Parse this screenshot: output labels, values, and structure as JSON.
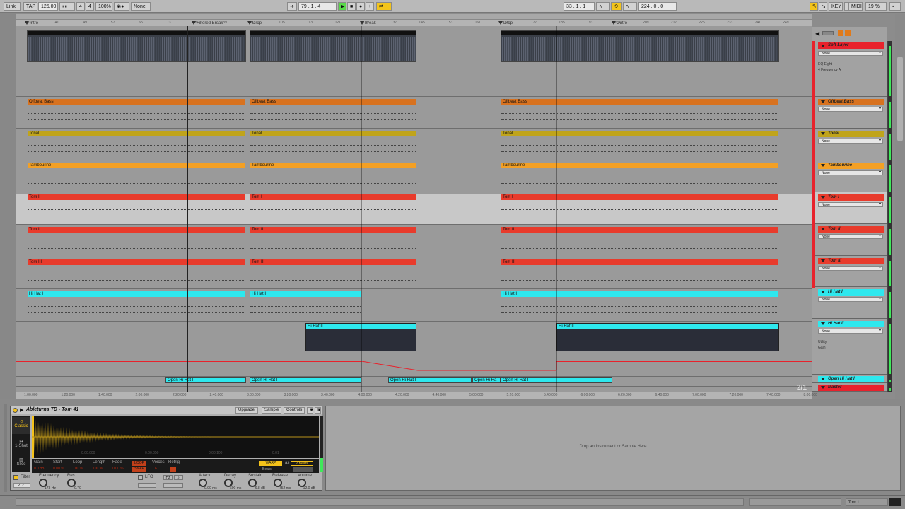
{
  "transport": {
    "link": "Link",
    "tap": "TAP",
    "tempo": "125.00",
    "sig_num": "4",
    "sig_den": "4",
    "zoom": "100%",
    "quant": "None",
    "position": "79 .  1 .  4",
    "loop_start": "33 .  1 .  1",
    "loop_length": "224 .  0 .  0",
    "key": "KEY",
    "midi": "MIDI",
    "cpu": "19 %"
  },
  "ruler": {
    "bars": [
      "33",
      "41",
      "49",
      "57",
      "65",
      "73",
      "81",
      "89",
      "97",
      "105",
      "113",
      "121",
      "129",
      "137",
      "145",
      "153",
      "161",
      "169",
      "177",
      "185",
      "193",
      "201",
      "209",
      "217",
      "225",
      "233",
      "241",
      "249"
    ],
    "locators": [
      "Intro",
      "Filtered Break",
      "Drop",
      "Break",
      "Drop",
      "Outro"
    ],
    "times": [
      "1:00:000",
      "1:20:000",
      "1:40:000",
      "2:00:000",
      "2:20:000",
      "2:40:000",
      "3:00:000",
      "3:20:000",
      "3:40:000",
      "4:00:000",
      "4:20:000",
      "4:40:000",
      "5:00:000",
      "5:20:000",
      "5:40:000",
      "6:00:000",
      "6:20:000",
      "6:40:000",
      "7:00:000",
      "7:20:000",
      "7:40:000",
      "8:00:000"
    ]
  },
  "tracks": [
    {
      "name": "Soft Layer",
      "color": "#e8222c",
      "device": "None",
      "auto1": "EQ Eight",
      "auto2": "4 Frequency A",
      "clips": []
    },
    {
      "name": "Offbeat Bass",
      "color": "#d8721f",
      "device": "None",
      "clips": [
        "Offbeat Bass",
        "Offbeat Bass",
        "Offbeat Bass"
      ]
    },
    {
      "name": "Tonal",
      "color": "#c0a41b",
      "device": "None",
      "clips": [
        "Tonal",
        "Tonal",
        "Tonal"
      ]
    },
    {
      "name": "Tambourine",
      "color": "#f3a025",
      "device": "None",
      "clips": [
        "Tambourine",
        "Tambourine",
        "Tambourine"
      ]
    },
    {
      "name": "Tom I",
      "color": "#e83b2c",
      "device": "None",
      "clips": [
        "Tom I",
        "Tom I",
        "Tom I"
      ]
    },
    {
      "name": "Tom II",
      "color": "#e83b2c",
      "device": "None",
      "clips": [
        "Tom II",
        "Tom II",
        "Tom II"
      ]
    },
    {
      "name": "Tom III",
      "color": "#e83b2c",
      "device": "None",
      "clips": [
        "Tom III",
        "Tom III",
        "Tom III"
      ]
    },
    {
      "name": "Hi Hat I",
      "color": "#2ee8ee",
      "device": "None",
      "clips": [
        "Hi Hat I",
        "Hi Hat I",
        "Hi Hat I"
      ]
    },
    {
      "name": "Hi Hat II",
      "color": "#2ee8ee",
      "device": "None",
      "auto1": "Utility",
      "auto2": "Gain",
      "clips": [
        "Hi Hat II",
        "Hi Hat II"
      ]
    },
    {
      "name": "Open Hi Hat I",
      "color": "#2ee8ee",
      "clips": [
        "Open Hi Hat I",
        "Open Hi Hat I",
        "Open Hi Hat I",
        "Open Hi Ha",
        "Open Hi Hat I"
      ]
    },
    {
      "name": "Master",
      "color": "#e8222c"
    }
  ],
  "page_indicator": "2/1",
  "device": {
    "title": "Ableturns TD - Tom 41",
    "tabs": [
      "Upgrade",
      "Sample",
      "Controls"
    ],
    "mode_label": "Classic",
    "mode2": "1-Shot",
    "mode3": "Slice",
    "ticks": [
      "0:00:000",
      "0:00:050",
      "0:00:100",
      "0:01"
    ],
    "params": [
      "Gain",
      "Start",
      "Loop",
      "Length",
      "Fade",
      "Voices",
      "Retrig"
    ],
    "param_vals": [
      "0.0 dB",
      "0.00 %",
      "100 %",
      "100 %",
      "0.00 %",
      "6",
      "Off"
    ],
    "warp": "WARP",
    "beats_val": "2 Beats",
    "beats": "Beats",
    "loop_btn": "LOOP",
    "snap_btn": "SNAP",
    "filter": "Filter",
    "filter_type": "LP12",
    "frequency": "Frequency",
    "freq_val": "173 Hz",
    "res": "Res",
    "res_val": "0.70",
    "lfo": "LFO",
    "hz": "Hz",
    "env": [
      "Attack",
      "Decay",
      "Sustain",
      "Release",
      "Volume"
    ],
    "env_vals": [
      "0.00 ms",
      "600 ms",
      "-6.8 dB",
      "752 ms",
      "-12.0 dB"
    ]
  },
  "drop_zone_text": "Drop an Instrument or Sample Here",
  "status": {
    "track_label": "Tom I"
  }
}
